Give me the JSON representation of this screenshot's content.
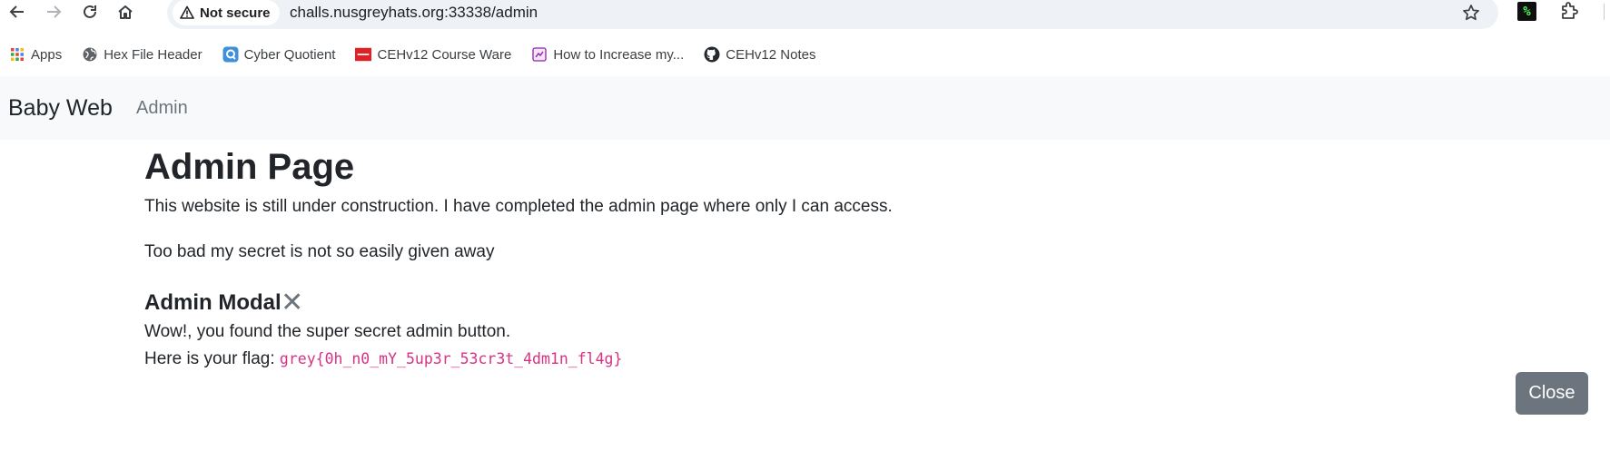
{
  "browser": {
    "security_label": "Not secure",
    "url": "challs.nusgreyhats.org:33338/admin",
    "extension_label": "%",
    "bookmarks": [
      {
        "label": "Apps",
        "icon": "apps-grid-icon"
      },
      {
        "label": "Hex File Header",
        "icon": "globe-icon"
      },
      {
        "label": "Cyber Quotient",
        "icon": "cyber-quotient-icon"
      },
      {
        "label": "CEHv12 Course Ware",
        "icon": "ec-council-icon"
      },
      {
        "label": "How to Increase my...",
        "icon": "bookmark-page-icon"
      },
      {
        "label": "CEHv12 Notes",
        "icon": "github-icon"
      }
    ]
  },
  "navbar": {
    "brand": "Baby Web",
    "link": "Admin"
  },
  "main": {
    "title": "Admin Page",
    "paragraph1": "This website is still under construction. I have completed the admin page where only I can access.",
    "paragraph2": "Too bad my secret is not so easily given away"
  },
  "modal": {
    "title": "Admin Modal",
    "close_x": "✕",
    "line1": "Wow!, you found the super secret admin button.",
    "flag_prefix": "Here is your flag: ",
    "flag": "grey{0h_n0_mY_5up3r_53cr3t_4dm1n_fl4g}",
    "close_label": "Close"
  },
  "colors": {
    "navbar_bg": "#f8f9fa",
    "flag_color": "#d63384",
    "close_button_bg": "#6c757d"
  }
}
